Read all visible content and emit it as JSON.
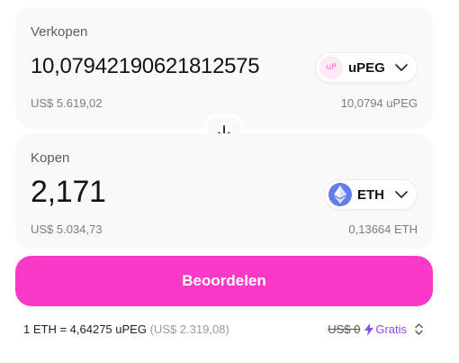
{
  "sell": {
    "label": "Verkopen",
    "amount": "10,07942190621812575",
    "usd_value": "US$ 5.619,02",
    "token": {
      "symbol": "uPEG",
      "icon": "upeg-token-icon",
      "icon_text": "uP"
    },
    "balance": "10,0794 uPEG"
  },
  "buy": {
    "label": "Kopen",
    "amount": "2,171",
    "usd_value": "US$ 5.034,73",
    "token": {
      "symbol": "ETH",
      "icon": "eth-token-icon"
    },
    "balance": "0,13664 ETH"
  },
  "swap_direction_icon": "arrow-down-icon",
  "review_button": {
    "label": "Beoordelen"
  },
  "footer": {
    "rate": "1 ETH = 4,64275 uPEG",
    "rate_usd": "(US$ 2.319,08)",
    "fee_old": "US$ 0",
    "fee_new": "Gratis",
    "fee_icon": "lightning-icon",
    "expand_icon": "chevron-up-down-icon"
  },
  "colors": {
    "accent": "#fc38c7",
    "panel_bg": "#f9f9f9",
    "eth": "#627eea",
    "gratis": "#8a4bff"
  }
}
